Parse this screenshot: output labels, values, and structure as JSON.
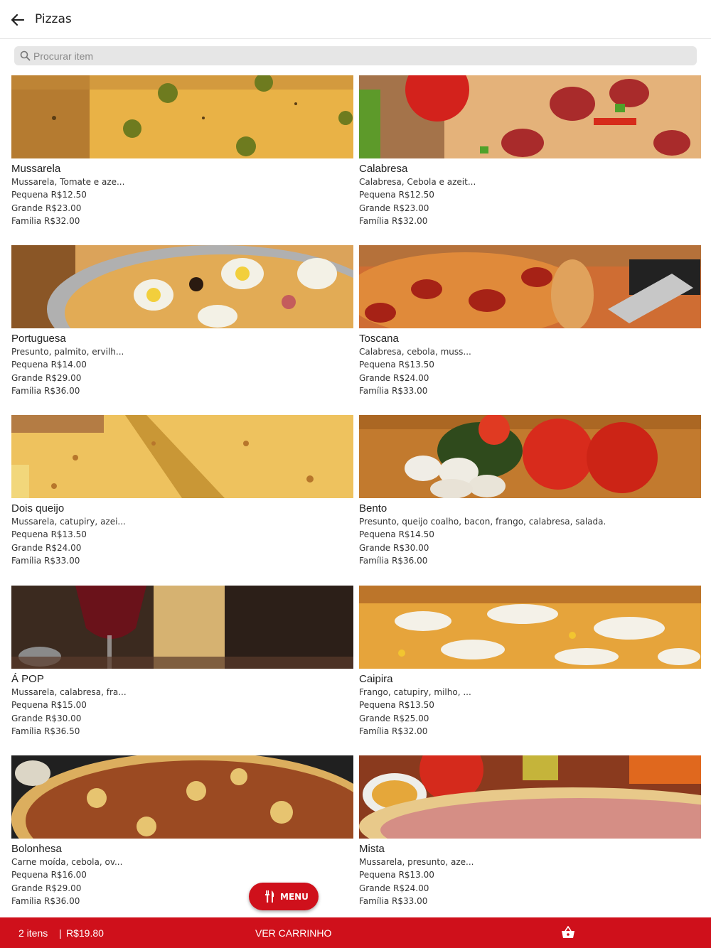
{
  "header": {
    "title": "Pizzas",
    "back_icon": "arrow-left-icon"
  },
  "search": {
    "placeholder": "Procurar item",
    "icon": "search-icon"
  },
  "items": [
    {
      "name": "Mussarela",
      "desc": "Mussarela, Tomate e aze...",
      "prices": [
        "Pequena  R$12.50",
        "Grande  R$23.00",
        "Família  R$32.00"
      ]
    },
    {
      "name": "Calabresa",
      "desc": "Calabresa, Cebola e azeit...",
      "prices": [
        "Pequena  R$12.50",
        "Grande  R$23.00",
        "Família  R$32.00"
      ]
    },
    {
      "name": "Portuguesa",
      "desc": "Presunto, palmito, ervilh...",
      "prices": [
        "Pequena  R$14.00",
        "Grande  R$29.00",
        "Família  R$36.00"
      ]
    },
    {
      "name": "Toscana",
      "desc": "Calabresa, cebola, muss...",
      "prices": [
        "Pequena  R$13.50",
        "Grande  R$24.00",
        "Família  R$33.00"
      ]
    },
    {
      "name": "Dois queijo",
      "desc": "Mussarela, catupiry, azei...",
      "prices": [
        "Pequena  R$13.50",
        "Grande  R$24.00",
        "Família  R$33.00"
      ]
    },
    {
      "name": "Bento",
      "desc": "Presunto, queijo coalho, bacon, frango, calabresa, salada.",
      "prices": [
        "Pequena  R$14.50",
        "Grande  R$30.00",
        "Família  R$36.00"
      ]
    },
    {
      "name": "Á POP",
      "desc": "Mussarela, calabresa, fra...",
      "prices": [
        "Pequena  R$15.00",
        "Grande  R$30.00",
        "Família  R$36.50"
      ]
    },
    {
      "name": "Caipira",
      "desc": "Frango, catupiry, milho, ...",
      "prices": [
        "Pequena  R$13.50",
        "Grande  R$25.00",
        "Família  R$32.00"
      ]
    },
    {
      "name": "Bolonhesa",
      "desc": "Carne moída, cebola, ov...",
      "prices": [
        "Pequena  R$16.00",
        "Grande  R$29.00",
        "Família  R$36.00"
      ]
    },
    {
      "name": "Mista",
      "desc": "Mussarela, presunto, aze...",
      "prices": [
        "Pequena  R$13.00",
        "Grande  R$24.00",
        "Família  R$33.00"
      ]
    }
  ],
  "fab": {
    "label": "MENU",
    "icon": "fork-knife-icon"
  },
  "bottom_bar": {
    "items_count": "2 itens",
    "separator": "|",
    "total": "R$19.80",
    "view_cart": "VER CARRINHO",
    "cart_icon": "basket-icon"
  },
  "colors": {
    "accent": "#cf101b",
    "search_bg": "#e6e6e6"
  }
}
